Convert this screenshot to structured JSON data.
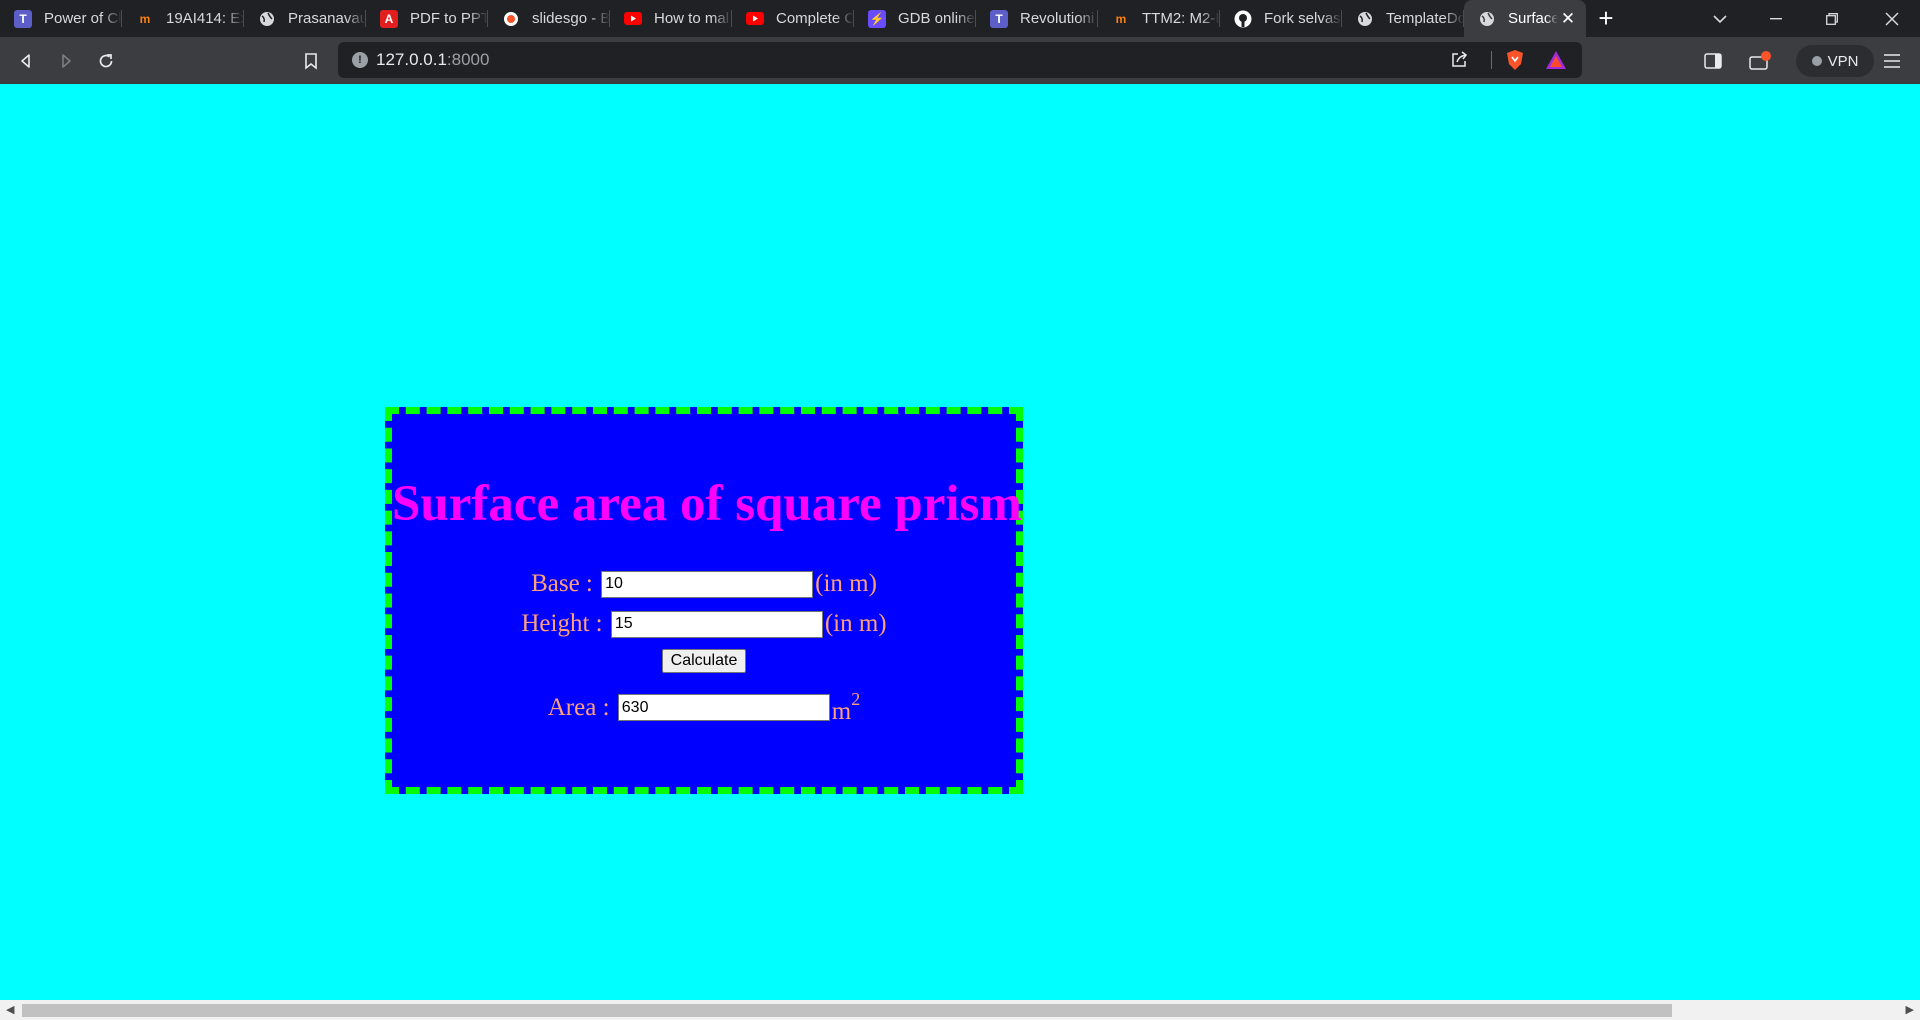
{
  "browser": {
    "tabs": [
      {
        "title": "Power of Cl",
        "icon": "teams-icon",
        "color": "#5b5fc7"
      },
      {
        "title": "19AI414: Ex",
        "icon": "moodle-icon",
        "color": "#f98012"
      },
      {
        "title": "Prasanavau",
        "icon": "globe-icon",
        "color": "#d7d9dc"
      },
      {
        "title": "PDF to PPT:",
        "icon": "adobe-pdf-icon",
        "color": "#ff0000"
      },
      {
        "title": "slidesgo - B",
        "icon": "brave-search-icon",
        "color": "#d7d9dc"
      },
      {
        "title": "How to mal",
        "icon": "youtube-icon",
        "color": "#ff0000"
      },
      {
        "title": "Complete C",
        "icon": "youtube-icon",
        "color": "#ff0000"
      },
      {
        "title": "GDB online",
        "icon": "gdb-icon",
        "color": "#6a4cff"
      },
      {
        "title": "Revolutioni",
        "icon": "teams-icon",
        "color": "#5b5fc7"
      },
      {
        "title": "TTM2: M2-I",
        "icon": "moodle-icon",
        "color": "#f98012"
      },
      {
        "title": "Fork selvas",
        "icon": "github-icon",
        "color": "#ffffff"
      },
      {
        "title": "TemplateDc",
        "icon": "globe-icon",
        "color": "#d7d9dc"
      },
      {
        "title": "Surface",
        "icon": "globe-icon",
        "color": "#d7d9dc",
        "active": true
      }
    ],
    "address": {
      "host": "127.0.0.1",
      "port": ":8000"
    },
    "vpn_label": "VPN"
  },
  "page": {
    "background": "#00ffff",
    "title": "Surface area of square prism",
    "base": {
      "label": "Base :",
      "value": "10",
      "unit": "(in m)"
    },
    "height": {
      "label": "Height :",
      "value": "15",
      "unit": "(in m)"
    },
    "button_label": "Calculate",
    "area": {
      "label": "Area :",
      "value": "630",
      "unit": "m",
      "exponent": "2"
    },
    "colors": {
      "box": "#0000ff",
      "border": "#00ff00",
      "title": "#ff00ff",
      "label": "#ffa07a"
    }
  }
}
